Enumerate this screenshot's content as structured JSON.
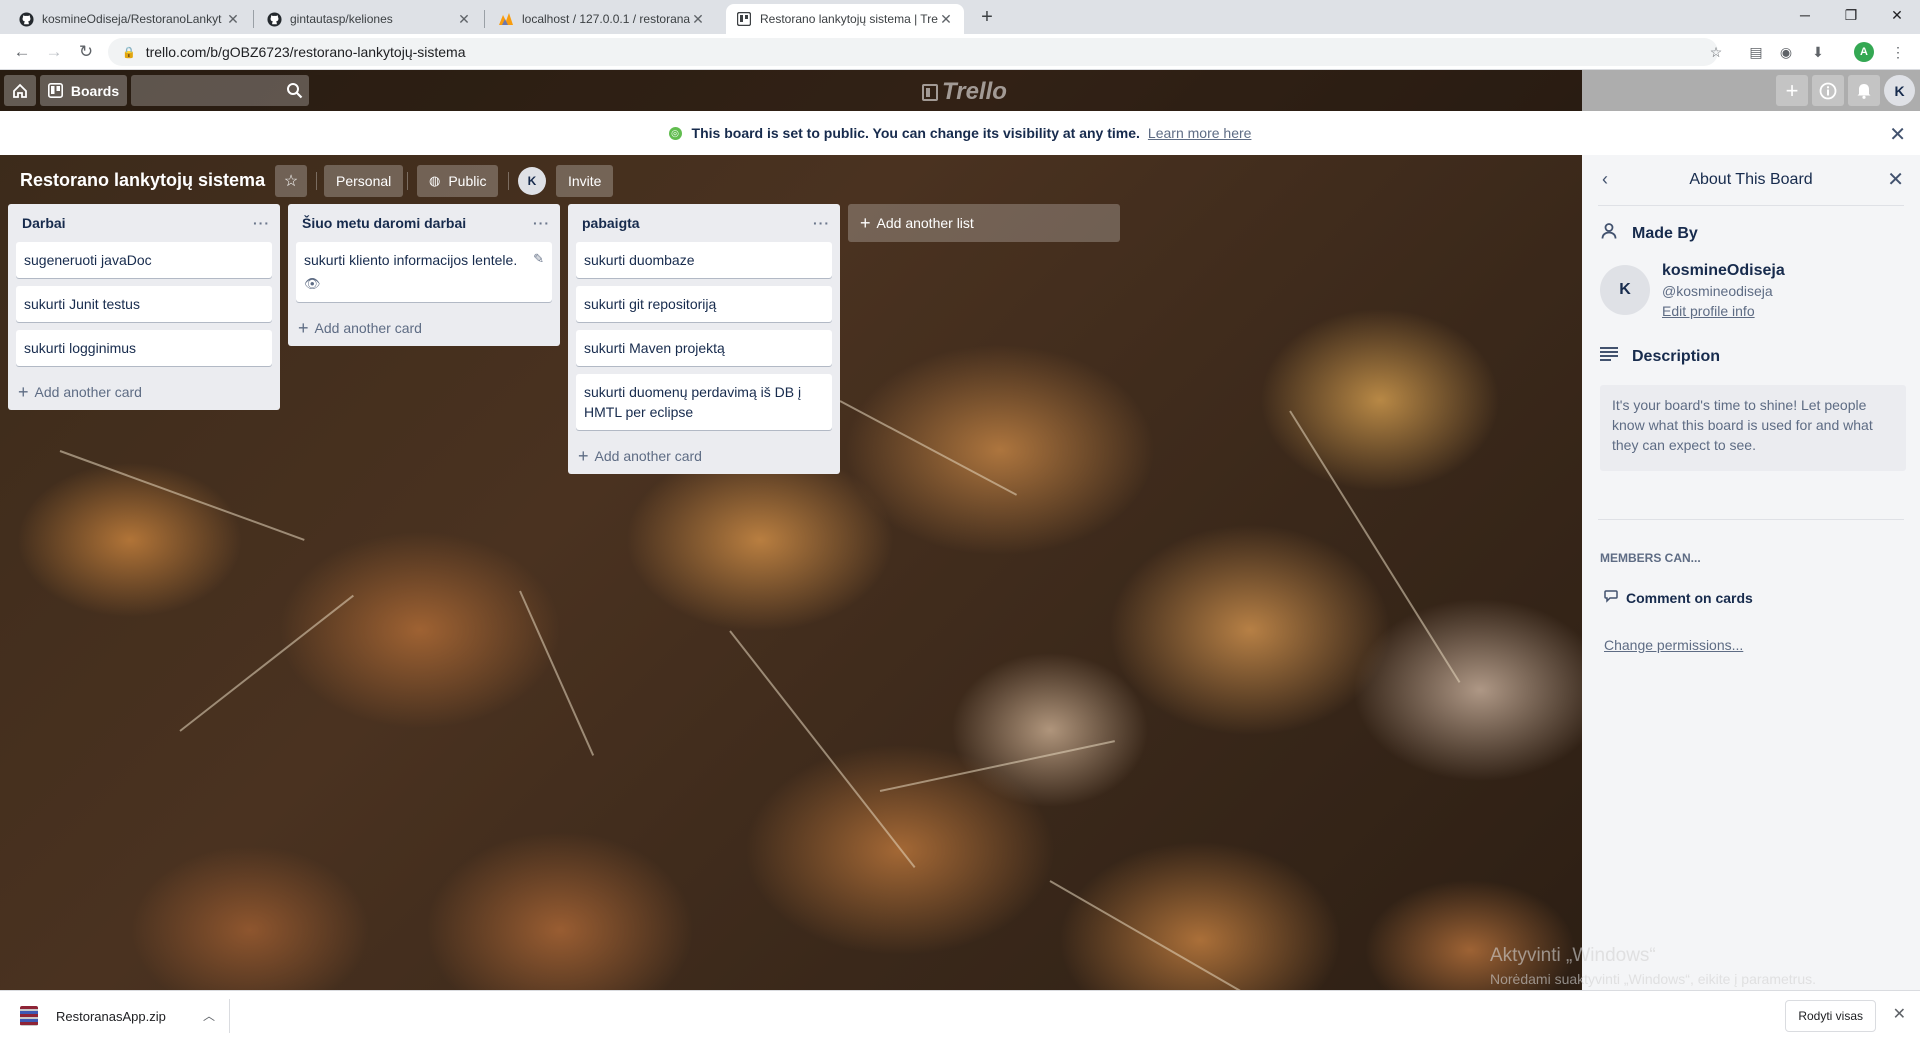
{
  "browser": {
    "tabs": [
      {
        "title": "kosmineOdiseja/RestoranoLankyt",
        "favicon": "github-icon",
        "active": false
      },
      {
        "title": "gintautasp/keliones",
        "favicon": "github-icon",
        "active": false
      },
      {
        "title": "localhost / 127.0.0.1 / restoranas",
        "favicon": "phpmyadmin-icon",
        "active": false
      },
      {
        "title": "Restorano lankytojų sistema | Tre",
        "favicon": "trello-icon",
        "active": true
      }
    ],
    "url": "trello.com/b/gOBZ6723/restorano-lankytojų-sistema",
    "profile_initial": "A"
  },
  "header": {
    "boards_label": "Boards",
    "logo_text": "Trello",
    "user_initial": "K"
  },
  "banner": {
    "message": "This board is set to public. You can change its visibility at any time.",
    "link": "Learn more here"
  },
  "board": {
    "title": "Restorano lankytojų sistema",
    "team_label": "Personal",
    "visibility_label": "Public",
    "member_initial": "K",
    "invite_label": "Invite",
    "add_list_label": "Add another list",
    "add_card_label": "Add another card",
    "lists": [
      {
        "name": "Darbai",
        "cards": [
          "sugeneruoti javaDoc",
          "sukurti Junit testus",
          "sukurti logginimus"
        ]
      },
      {
        "name": "Šiuo metu daromi darbai",
        "cards": [
          "sukurti kliento informacijos lentele."
        ]
      },
      {
        "name": "pabaigta",
        "cards": [
          "sukurti duombaze",
          "sukurti git repositoriją",
          "sukurti Maven projektą",
          "sukurti duomenų perdavimą iš DB į HMTL per eclipse"
        ]
      }
    ]
  },
  "sidebar": {
    "title": "About This Board",
    "made_by_label": "Made By",
    "avatar_initial": "K",
    "user_name": "kosmineOdiseja",
    "user_handle": "@kosmineodiseja",
    "edit_profile_label": "Edit profile info",
    "description_label": "Description",
    "description_placeholder": "It's your board's time to shine! Let people know what this board is used for and what they can expect to see.",
    "members_can_label": "MEMBERS CAN...",
    "permission_label": "Comment on cards",
    "change_permissions_label": "Change permissions..."
  },
  "watermark": {
    "line1": "Aktyvinti „Windows“",
    "line2": "Norėdami suaktyvinti „Windows“, eikite į parametrus."
  },
  "downloads": {
    "file_name": "RestoranasApp.zip",
    "show_all_label": "Rodyti visas"
  }
}
